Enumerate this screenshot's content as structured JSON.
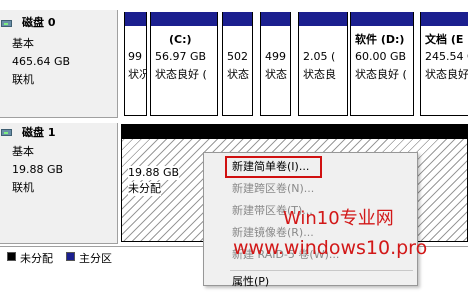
{
  "disk0": {
    "title": "磁盘 0",
    "type": "基本",
    "size": "465.64 GB",
    "status": "联机"
  },
  "disk1": {
    "title": "磁盘 1",
    "type": "基本",
    "size": "19.88 GB",
    "status": "联机"
  },
  "partitions": [
    {
      "name": "",
      "size": "99",
      "status": "状况"
    },
    {
      "name": "(C:)",
      "size": "56.97 GB",
      "status": "状态良好 ("
    },
    {
      "name": "",
      "size": "502",
      "status": "状态"
    },
    {
      "name": "",
      "size": "499",
      "status": "状态"
    },
    {
      "name": "",
      "size": "2.05 (",
      "status": "状态良"
    },
    {
      "name": "软件  (D:)",
      "size": "60.00 GB",
      "status": "状态良好 ("
    },
    {
      "name": "文档  (E",
      "size": "245.54 G",
      "status": "状态良好"
    }
  ],
  "unallocated": {
    "size": "19.88 GB",
    "label": "未分配"
  },
  "legend": {
    "unallocated": "未分配",
    "primary": "主分区"
  },
  "menu": {
    "new_simple": "新建简单卷(I)...",
    "new_spanned": "新建跨区卷(N)...",
    "new_striped": "新建带区卷(T)...",
    "new_mirrored": "新建镜像卷(R)...",
    "new_raid5": "新建 RAID-5 卷(W)...",
    "properties": "属性(P)"
  },
  "watermark": {
    "line1": "Win10专业网",
    "line2": "www.windows10.pro"
  },
  "colors": {
    "primary": "#1b1f8f",
    "highlight": "#d01010",
    "watermark": "#d21818"
  }
}
